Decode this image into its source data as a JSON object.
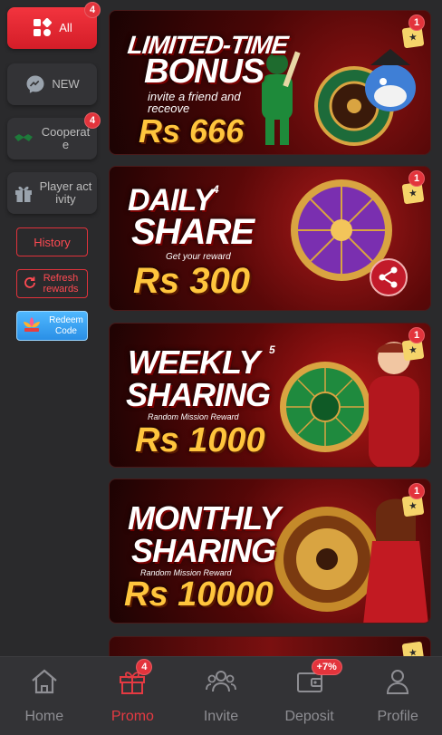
{
  "sidebar": {
    "tabs": [
      {
        "label": "All",
        "badge": "4",
        "icon": "grid-icon"
      },
      {
        "label": "NEW",
        "icon": "messenger-icon"
      },
      {
        "label": "Cooperate",
        "badge": "4",
        "icon": "handshake-icon"
      },
      {
        "label": "Player activity",
        "icon": "gift-box-icon"
      }
    ],
    "history_label": "History",
    "refresh_label": "Refresh rewards",
    "redeem_label": "Redeem Code"
  },
  "banners": [
    {
      "line1": "LIMITED-TIME",
      "line2": "BONUS",
      "sub": "invite a friend and receove",
      "amount": "Rs 666",
      "badge": "1"
    },
    {
      "line1": "DAILY",
      "sup": "4",
      "line2": "SHARE",
      "sub": "Get your reward",
      "amount": "Rs 300",
      "badge": "1"
    },
    {
      "line1": "WEEKLY",
      "sup": "5",
      "line2": "SHARING",
      "sub": "Random Mission Reward",
      "amount": "Rs 1000",
      "badge": "1"
    },
    {
      "line1": "MONTHLY",
      "line2": "SHARING",
      "sub": "Random Mission Reward",
      "amount": "Rs 10000",
      "badge": "1"
    }
  ],
  "nav": {
    "items": [
      {
        "label": "Home",
        "icon": "home-icon"
      },
      {
        "label": "Promo",
        "icon": "gift-icon",
        "badge": "4"
      },
      {
        "label": "Invite",
        "icon": "users-icon"
      },
      {
        "label": "Deposit",
        "icon": "wallet-icon",
        "badge": "+7%"
      },
      {
        "label": "Profile",
        "icon": "person-icon"
      }
    ]
  },
  "colors": {
    "accent": "#e53a42",
    "background": "#2a2a2c",
    "panel": "#333336",
    "gold": "#ffc53d"
  }
}
